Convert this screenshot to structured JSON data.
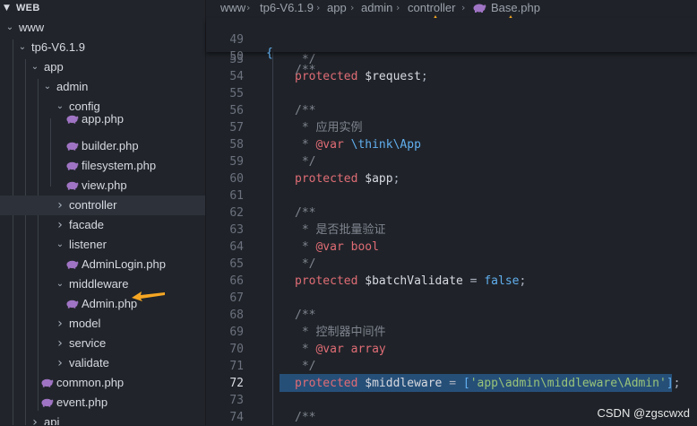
{
  "sidebar": {
    "header": "WEB",
    "items": [
      {
        "label": "www",
        "type": "folder",
        "open": true
      },
      {
        "label": "tp6-V6.1.9",
        "type": "folder",
        "open": true
      },
      {
        "label": "app",
        "type": "folder",
        "open": true
      },
      {
        "label": "admin",
        "type": "folder",
        "open": true
      },
      {
        "label": "config",
        "type": "folder",
        "open": true
      },
      {
        "label": "app.php",
        "type": "file"
      },
      {
        "label": "builder.php",
        "type": "file"
      },
      {
        "label": "filesystem.php",
        "type": "file"
      },
      {
        "label": "view.php",
        "type": "file"
      },
      {
        "label": "controller",
        "type": "folder",
        "open": false,
        "selected": true
      },
      {
        "label": "facade",
        "type": "folder",
        "open": false
      },
      {
        "label": "listener",
        "type": "folder",
        "open": true
      },
      {
        "label": "AdminLogin.php",
        "type": "file"
      },
      {
        "label": "middleware",
        "type": "folder",
        "open": true
      },
      {
        "label": "Admin.php",
        "type": "file"
      },
      {
        "label": "model",
        "type": "folder",
        "open": false
      },
      {
        "label": "service",
        "type": "folder",
        "open": false
      },
      {
        "label": "validate",
        "type": "folder",
        "open": false
      },
      {
        "label": "common.php",
        "type": "file"
      },
      {
        "label": "event.php",
        "type": "file"
      },
      {
        "label": "api",
        "type": "folder",
        "open": false
      }
    ]
  },
  "breadcrumbs": [
    "www",
    "tp6-V6.1.9",
    "app",
    "admin",
    "controller",
    "Base.php"
  ],
  "code": {
    "sticky": [
      {
        "num": "49",
        "text": "{"
      },
      {
        "num": "50",
        "text": "/**"
      }
    ],
    "lines": [
      {
        "num": "53",
        "text": " */"
      },
      {
        "num": "54",
        "text": "protected $request;"
      },
      {
        "num": "55",
        "text": ""
      },
      {
        "num": "56",
        "text": "/**"
      },
      {
        "num": "57",
        "text": " * 应用实例"
      },
      {
        "num": "58",
        "text": " * @var \\think\\App"
      },
      {
        "num": "59",
        "text": " */"
      },
      {
        "num": "60",
        "text": "protected $app;"
      },
      {
        "num": "61",
        "text": ""
      },
      {
        "num": "62",
        "text": "/**"
      },
      {
        "num": "63",
        "text": " * 是否批量验证"
      },
      {
        "num": "64",
        "text": " * @var bool"
      },
      {
        "num": "65",
        "text": " */"
      },
      {
        "num": "66",
        "text": "protected $batchValidate = false;"
      },
      {
        "num": "67",
        "text": ""
      },
      {
        "num": "68",
        "text": "/**"
      },
      {
        "num": "69",
        "text": " * 控制器中间件"
      },
      {
        "num": "70",
        "text": " * @var array"
      },
      {
        "num": "71",
        "text": " */"
      },
      {
        "num": "72",
        "text": "protected $middleware = ['app\\admin\\middleware\\Admin'];",
        "active": true
      },
      {
        "num": "73",
        "text": ""
      },
      {
        "num": "74",
        "text": "/**"
      }
    ]
  },
  "watermark": "CSDN @zgscwxd",
  "colors": {
    "annotation_arrow": "#f5a623",
    "selection": "#264f78",
    "keyword": "#e06c75",
    "string": "#98c379"
  }
}
